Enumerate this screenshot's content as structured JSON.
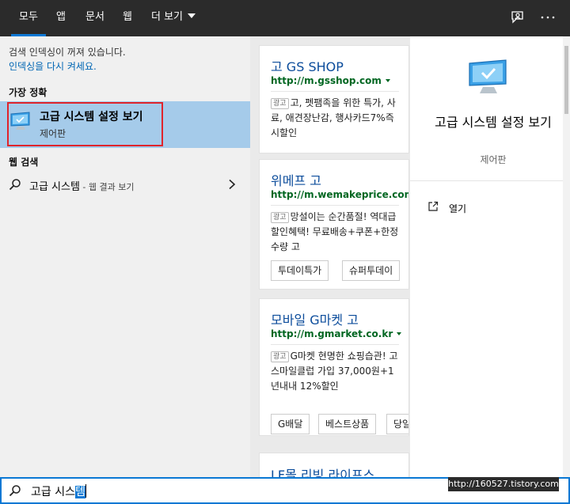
{
  "topbar": {
    "tabs": [
      {
        "label": "모두",
        "active": true
      },
      {
        "label": "앱",
        "active": false
      },
      {
        "label": "문서",
        "active": false
      },
      {
        "label": "웹",
        "active": false
      },
      {
        "label": "더 보기",
        "active": false
      }
    ],
    "icons": [
      "feedback-icon",
      "more-options-icon"
    ],
    "accent": "#0a78d4"
  },
  "left": {
    "notice_line1": "검색 인덱싱이 꺼져 있습니다.",
    "notice_line2": "인덱싱을 다시 켜세요.",
    "best_match_heading": "가장 정확",
    "best_match": {
      "title": "고급 시스템 설정 보기",
      "subtitle": "제어판",
      "icon": "computer-settings-icon"
    },
    "web_heading": "웹 검색",
    "web_item": {
      "query": "고급 시스템",
      "suffix": " - 웹 결과 보기"
    }
  },
  "ads": [
    {
      "title": "고 GS SHOP",
      "url": "http://m.gsshop.com",
      "badge": "광고",
      "text": "고, 펫팸족을 위한 특가, 사료, 애견장난감, 행사카드7%즉시할인",
      "chips": []
    },
    {
      "title": "위메프 고",
      "url": "http://m.wemakeprice.com",
      "badge": "광고",
      "text": "망설이는 순간품절! 역대급 할인혜택! 무료배송+쿠폰+한정수량 고",
      "chips": [
        "투데이특가",
        "슈퍼투데이"
      ]
    },
    {
      "title": "모바일 G마켓 고",
      "url": "http://m.gmarket.co.kr",
      "badge": "광고",
      "text": "G마켓 현명한 쇼핑습관! 고 스마일클럽 가입 37,000원+1년내내 12%할인",
      "chips": [
        "G배달",
        "베스트상품",
        "당일"
      ]
    },
    {
      "title": "LF몰 리빙 라이프스",
      "url": "",
      "badge": "",
      "text": "",
      "chips": []
    }
  ],
  "detail": {
    "title": "고급 시스템 설정 보기",
    "subtitle": "제어판",
    "action_open": "열기"
  },
  "searchbar": {
    "typed": "고급 시스",
    "composing": "템"
  },
  "watermark": "http://160527.tistory.com"
}
